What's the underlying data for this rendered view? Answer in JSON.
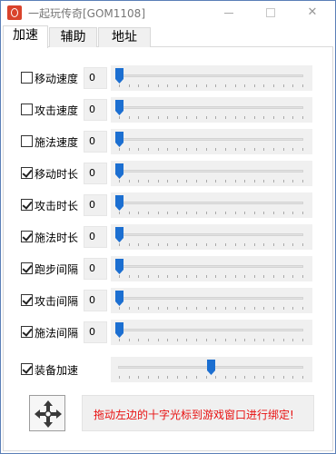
{
  "window": {
    "title": "一起玩传奇[GOM1108]",
    "icons": {
      "app": "app-logo-icon",
      "minimize": "minimize-icon",
      "maximize": "maximize-icon",
      "close": "close-icon"
    },
    "close_glyph": "✕"
  },
  "tabs": [
    {
      "label": "加速",
      "active": true
    },
    {
      "label": "辅助",
      "active": false
    },
    {
      "label": "地址",
      "active": false
    }
  ],
  "settings": [
    {
      "label": "移动速度",
      "checked": false,
      "value": "0",
      "level": 0.0
    },
    {
      "label": "攻击速度",
      "checked": false,
      "value": "0",
      "level": 0.0
    },
    {
      "label": "施法速度",
      "checked": false,
      "value": "0",
      "level": 0.0
    },
    {
      "label": "移动时长",
      "checked": true,
      "value": "0",
      "level": 0.0
    },
    {
      "label": "攻击时长",
      "checked": true,
      "value": "0",
      "level": 0.0
    },
    {
      "label": "施法时长",
      "checked": true,
      "value": "0",
      "level": 0.0
    },
    {
      "label": "跑步间隔",
      "checked": true,
      "value": "0",
      "level": 0.0
    },
    {
      "label": "攻击间隔",
      "checked": true,
      "value": "0",
      "level": 0.0
    },
    {
      "label": "施法间隔",
      "checked": true,
      "value": "0",
      "level": 0.0
    }
  ],
  "gear_speed": {
    "label": "装备加速",
    "checked": true,
    "level": 0.5
  },
  "slider_ticks": 20,
  "bind": {
    "crosshair_icon": "crosshair-drag-icon",
    "hint": "拖动左边的十字光标到游戏窗口进行绑定!"
  },
  "colors": {
    "thumb": "#1c6fd1",
    "hint": "#e81010"
  }
}
